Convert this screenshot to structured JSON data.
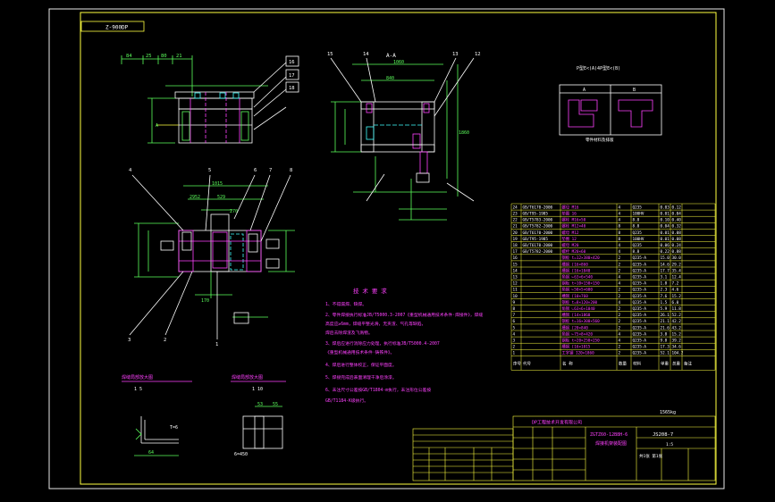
{
  "drawing": {
    "code_box": "Z-900DP",
    "section_label": "A-A",
    "detail_title": "P型E<(A)4P型E<(B)",
    "detail_sub_a": "A",
    "detail_sub_b": "B",
    "detail_caption": "零件材料及排版",
    "note_heading": "技 术 要 求",
    "notes": [
      "1、不得漏焊、缺焊。",
      "2、零件焊接执行标准JB/T5000.3-2007《重型机械通用技术条件·焊接件》，焊缝",
      "   高度应≥6mm，焊缝平整光滑，无夹渣、气孔等缺陷，",
      "   焊后去除焊渣及飞溅物。",
      "3、焊后应进行消除应力处理，执行标准JB/T5000.4-2007",
      "   《重型机械通用技术条件·铸铁件》。",
      "4、焊后进行整体校正，保证平面度。",
      "5、焊接完成后表面清理干净后涂漆。",
      "6、未注尺寸公差按GB/T1804-m执行，未注形位公差按",
      "   GB/T1184-K级执行。"
    ],
    "view_label_1": "焊缝局部放大图",
    "view_label_1_scale": "1    5",
    "view_label_2": "焊缝局部放大图",
    "view_label_2_scale": "1    10",
    "dims_top": [
      "84",
      "25",
      "80",
      "21"
    ],
    "dims_section": [
      "15",
      "14",
      "1060",
      "13",
      "12",
      "840",
      "1860"
    ],
    "dims_plan": [
      "1015",
      "529",
      "2952",
      "270",
      "170",
      "68"
    ],
    "balloons": [
      "4",
      "5",
      "6",
      "7",
      "8",
      "16",
      "17",
      "18",
      "19",
      "3",
      "2",
      "1"
    ],
    "dim_small": [
      "T=6",
      "64",
      "53",
      "55",
      "6=450"
    ],
    "title_block": {
      "drawing_no": "JS208-7",
      "name": "ZGTZ60-12B8H-6",
      "sub_name": "焊接机架装配图",
      "weight": "1565kg",
      "scale": "1:5",
      "company": "DP工程技术开发有限公司",
      "sheet": "共1张 第1张"
    }
  },
  "bom": {
    "rows": [
      {
        "no": "24",
        "code": "GB/T6170-2000",
        "name": "螺母 M16",
        "qty": "4",
        "mat": "Q235",
        "w": "0.03",
        "t": "0.12"
      },
      {
        "no": "23",
        "code": "GB/T95-1985",
        "name": "垫圈 16",
        "qty": "4",
        "mat": "100HV",
        "w": "0.01",
        "t": "0.04"
      },
      {
        "no": "22",
        "code": "GB/T5783-2000",
        "name": "螺栓 M16×50",
        "qty": "4",
        "mat": "8.8",
        "w": "0.10",
        "t": "0.40"
      },
      {
        "no": "21",
        "code": "GB/T5782-2000",
        "name": "螺栓 M12×40",
        "qty": "8",
        "mat": "8.8",
        "w": "0.04",
        "t": "0.32"
      },
      {
        "no": "20",
        "code": "GB/T6170-2000",
        "name": "螺母 M12",
        "qty": "8",
        "mat": "Q235",
        "w": "0.01",
        "t": "0.08"
      },
      {
        "no": "19",
        "code": "GB/T95-1985",
        "name": "垫圈 12",
        "qty": "8",
        "mat": "100HV",
        "w": "0.01",
        "t": "0.08"
      },
      {
        "no": "18",
        "code": "GB/T6170-2000",
        "name": "螺母 M20",
        "qty": "4",
        "mat": "Q235",
        "w": "0.06",
        "t": "0.24"
      },
      {
        "no": "17",
        "code": "GB/T5782-2000",
        "name": "螺栓 M20×60",
        "qty": "4",
        "mat": "8.8",
        "w": "0.22",
        "t": "0.88"
      },
      {
        "no": "16",
        "code": "",
        "name": "钢板 t=12×380×420",
        "qty": "2",
        "mat": "Q235-A",
        "w": "15.0",
        "t": "30.0"
      },
      {
        "no": "15",
        "code": "",
        "name": "槽钢 [16×860",
        "qty": "2",
        "mat": "Q235-A",
        "w": "14.6",
        "t": "29.2"
      },
      {
        "no": "14",
        "code": "",
        "name": "槽钢 [16×1040",
        "qty": "2",
        "mat": "Q235-A",
        "w": "17.7",
        "t": "35.4"
      },
      {
        "no": "13",
        "code": "",
        "name": "角钢 ∟63×6×540",
        "qty": "4",
        "mat": "Q235-A",
        "w": "3.1",
        "t": "12.4"
      },
      {
        "no": "12",
        "code": "",
        "name": "钢板 t=10×150×150",
        "qty": "4",
        "mat": "Q235-A",
        "w": "1.8",
        "t": "7.2"
      },
      {
        "no": "11",
        "code": "",
        "name": "角钢 ∟50×5×600",
        "qty": "2",
        "mat": "Q235-A",
        "w": "2.3",
        "t": "4.6"
      },
      {
        "no": "10",
        "code": "",
        "name": "槽钢 [10×760",
        "qty": "2",
        "mat": "Q235-A",
        "w": "7.6",
        "t": "15.2"
      },
      {
        "no": "9",
        "code": "",
        "name": "钢板 t=8×120×200",
        "qty": "4",
        "mat": "Q235-A",
        "w": "1.5",
        "t": "6.0"
      },
      {
        "no": "8",
        "code": "",
        "name": "角钢 ∟63×6×1040",
        "qty": "2",
        "mat": "Q235-A",
        "w": "5.9",
        "t": "11.8"
      },
      {
        "no": "7",
        "code": "",
        "name": "槽钢 [14×1860",
        "qty": "2",
        "mat": "Q235-A",
        "w": "26.1",
        "t": "52.2"
      },
      {
        "no": "6",
        "code": "",
        "name": "钢板 t=16×300×560",
        "qty": "2",
        "mat": "Q235-A",
        "w": "21.1",
        "t": "42.2"
      },
      {
        "no": "5",
        "code": "",
        "name": "槽钢 [20×840",
        "qty": "2",
        "mat": "Q235-A",
        "w": "21.6",
        "t": "43.2"
      },
      {
        "no": "4",
        "code": "",
        "name": "角钢 ∟75×8×420",
        "qty": "4",
        "mat": "Q235-A",
        "w": "3.8",
        "t": "15.2"
      },
      {
        "no": "3",
        "code": "",
        "name": "钢板 t=20×250×250",
        "qty": "4",
        "mat": "Q235-A",
        "w": "9.8",
        "t": "39.2"
      },
      {
        "no": "2",
        "code": "",
        "name": "槽钢 [16×1015",
        "qty": "2",
        "mat": "Q235-A",
        "w": "17.3",
        "t": "34.6"
      },
      {
        "no": "1",
        "code": "",
        "name": "工字钢 I20×1860",
        "qty": "2",
        "mat": "Q235-A",
        "w": "52.1",
        "t": "104.2"
      }
    ],
    "header": {
      "no": "序号",
      "code": "代号",
      "name": "名 称",
      "qty": "数量",
      "mat": "材料",
      "w": "单重",
      "t": "总重",
      "remark": "备注"
    }
  }
}
